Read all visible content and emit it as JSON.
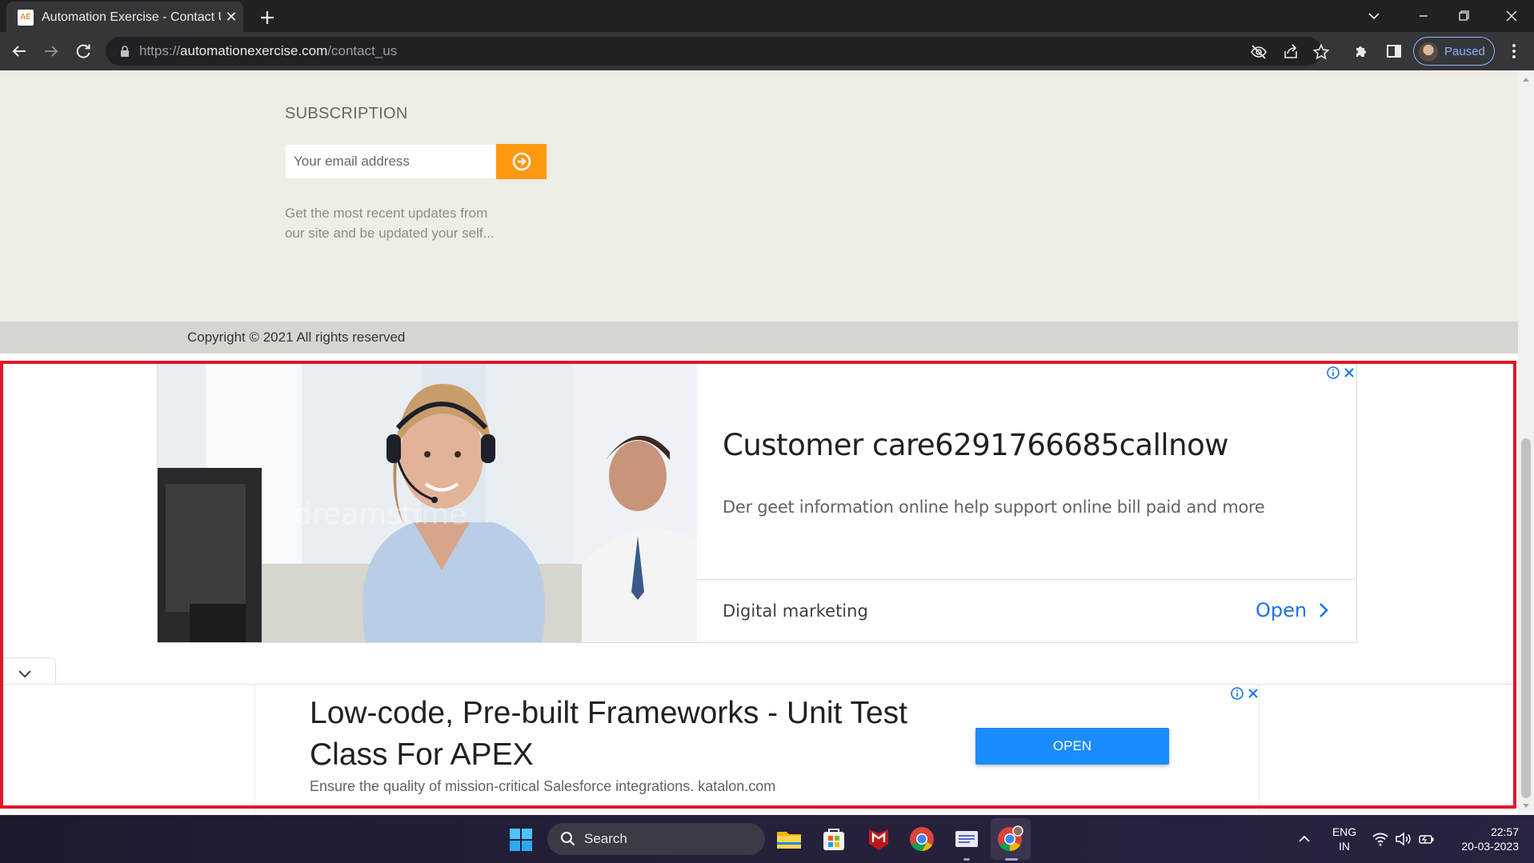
{
  "browser": {
    "tab_title": "Automation Exercise - Contact Us",
    "favicon_text": "AE",
    "url_scheme": "https://",
    "url_host": "automationexercise.com",
    "url_path": "/contact_us",
    "profile_status": "Paused"
  },
  "page": {
    "subscription_title": "SUBSCRIPTION",
    "email_placeholder": "Your email address",
    "subscription_desc_line1": "Get the most recent updates from",
    "subscription_desc_line2": "our site and be updated your self...",
    "copyright": "Copyright © 2021 All rights reserved"
  },
  "ads": {
    "ad1": {
      "image_watermark": "dreamstime",
      "headline": "Customer care6291766685callnow",
      "description": "Der geet information online help support online bill paid and more",
      "advertiser": "Digital marketing",
      "cta": "Open"
    },
    "ad2": {
      "headline": "Low-code, Pre-built Frameworks - Unit Test Class For APEX",
      "description": "Ensure the quality of mission-critical Salesforce integrations. katalon.com",
      "cta": "OPEN"
    }
  },
  "highlight_color": "#e0162b",
  "accent_color": "#fe980f",
  "taskbar": {
    "search_label": "Search",
    "lang_line1": "ENG",
    "lang_line2": "IN",
    "time": "22:57",
    "date": "20-03-2023"
  }
}
